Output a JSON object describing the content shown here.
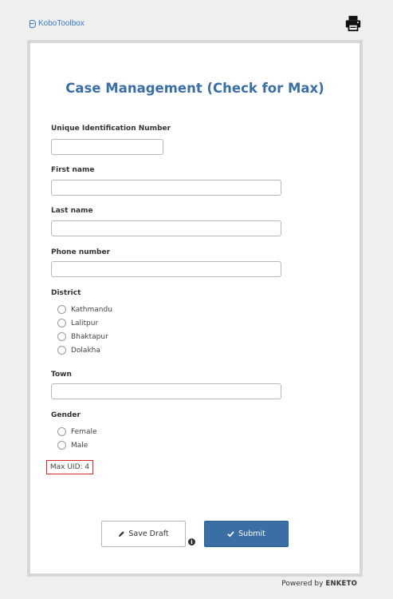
{
  "header": {
    "logo_text": "KoboToolbox"
  },
  "form": {
    "title": "Case Management (Check for Max)",
    "questions": {
      "uid": {
        "label": "Unique Identification Number",
        "value": ""
      },
      "first_name": {
        "label": "First name",
        "value": ""
      },
      "last_name": {
        "label": "Last name",
        "value": ""
      },
      "phone": {
        "label": "Phone number",
        "value": ""
      },
      "district": {
        "label": "District",
        "options": [
          "Kathmandu",
          "Lalitpur",
          "Bhaktapur",
          "Dolakha"
        ]
      },
      "town": {
        "label": "Town",
        "value": ""
      },
      "gender": {
        "label": "Gender",
        "options": [
          "Female",
          "Male"
        ]
      }
    },
    "max_uid_note": "Max UID: 4",
    "actions": {
      "save_draft": "Save Draft",
      "submit": "Submit"
    }
  },
  "footer": {
    "powered_by": "Powered by",
    "brand": "ENKETO"
  },
  "colors": {
    "primary": "#3a6ea5",
    "logo": "#3a7bbf",
    "highlight_border": "#d9252b",
    "background": "#efefef"
  }
}
